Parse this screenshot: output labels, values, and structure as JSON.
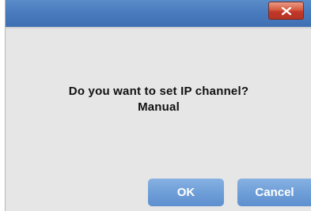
{
  "dialog": {
    "close_icon": "close-x-icon",
    "message_line1": "Do you want to set IP channel?",
    "message_line2": "Manual",
    "ok_label": "OK",
    "cancel_label": "Cancel"
  },
  "colors": {
    "titlebar": "#4a7bbf",
    "close_button": "#c0392b",
    "dialog_background": "#e6e6e6",
    "button": "#6f9fd8"
  }
}
